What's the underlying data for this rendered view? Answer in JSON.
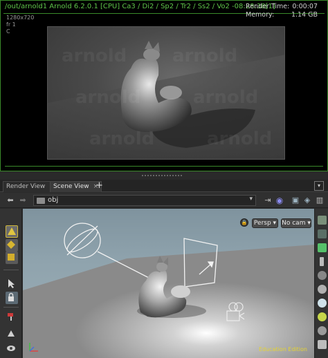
{
  "render_view": {
    "title": "/out/arnold1  Arnold 6.2.0.1 [CPU]  Ca3 / Di2 / Sp2 / Tr2 / Ss2 / Vo2 -08:28:38[1]",
    "stats": [
      {
        "label": "Render Time:",
        "value": "0:00:07"
      },
      {
        "label": "Memory:",
        "value": "1.14 GB"
      }
    ],
    "resolution": "1280x720",
    "frame": "fr 1",
    "channel": "C",
    "watermarks": [
      "arnold",
      "arnold",
      "arnold",
      "arnold",
      "arnold",
      "arnold"
    ]
  },
  "tabs": [
    {
      "label": "Render View",
      "active": false
    },
    {
      "label": "Scene View",
      "active": true
    }
  ],
  "tab_add": "+",
  "tab_close": "×",
  "path": {
    "value": "obj"
  },
  "viewport": {
    "persp_label": "Persp",
    "cam_label": "No cam",
    "edu_label": "Education Edition"
  },
  "colors": {
    "accent_green": "#5fc44a",
    "edu_yellow": "#e5d432"
  },
  "icons": {
    "nav_back": "arrow-left-icon",
    "nav_forward": "arrow-right-icon",
    "pin": "pin-icon",
    "network": "network-icon",
    "help": "help-icon"
  }
}
